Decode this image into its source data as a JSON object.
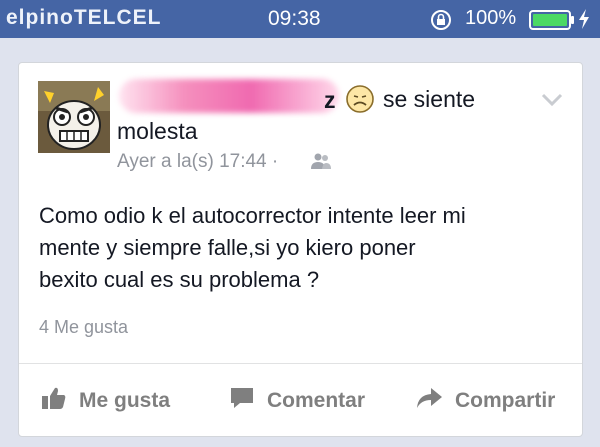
{
  "status_bar": {
    "carrier": "elpinoTELCEL",
    "time": "09:38",
    "battery_percent": "100%",
    "colors": {
      "background": "#4565a5",
      "battery_fill": "#4cd964"
    }
  },
  "post": {
    "author_suffix": "z",
    "feeling_prefix": "se siente",
    "feeling": "molesta",
    "timestamp": "Ayer a la(s) 17:44 ·",
    "text_lines": [
      "Como odio k el autocorrector intente  leer mi",
      "mente y siempre falle,si yo kiero poner",
      "bexito cual es su problema ?"
    ],
    "likes": "4 Me gusta"
  },
  "actions": {
    "like": "Me gusta",
    "comment": "Comentar",
    "share": "Compartir"
  },
  "icons": {
    "audience": "friends-icon",
    "feeling": "sad-face-icon",
    "menu": "chevron-down-icon"
  }
}
